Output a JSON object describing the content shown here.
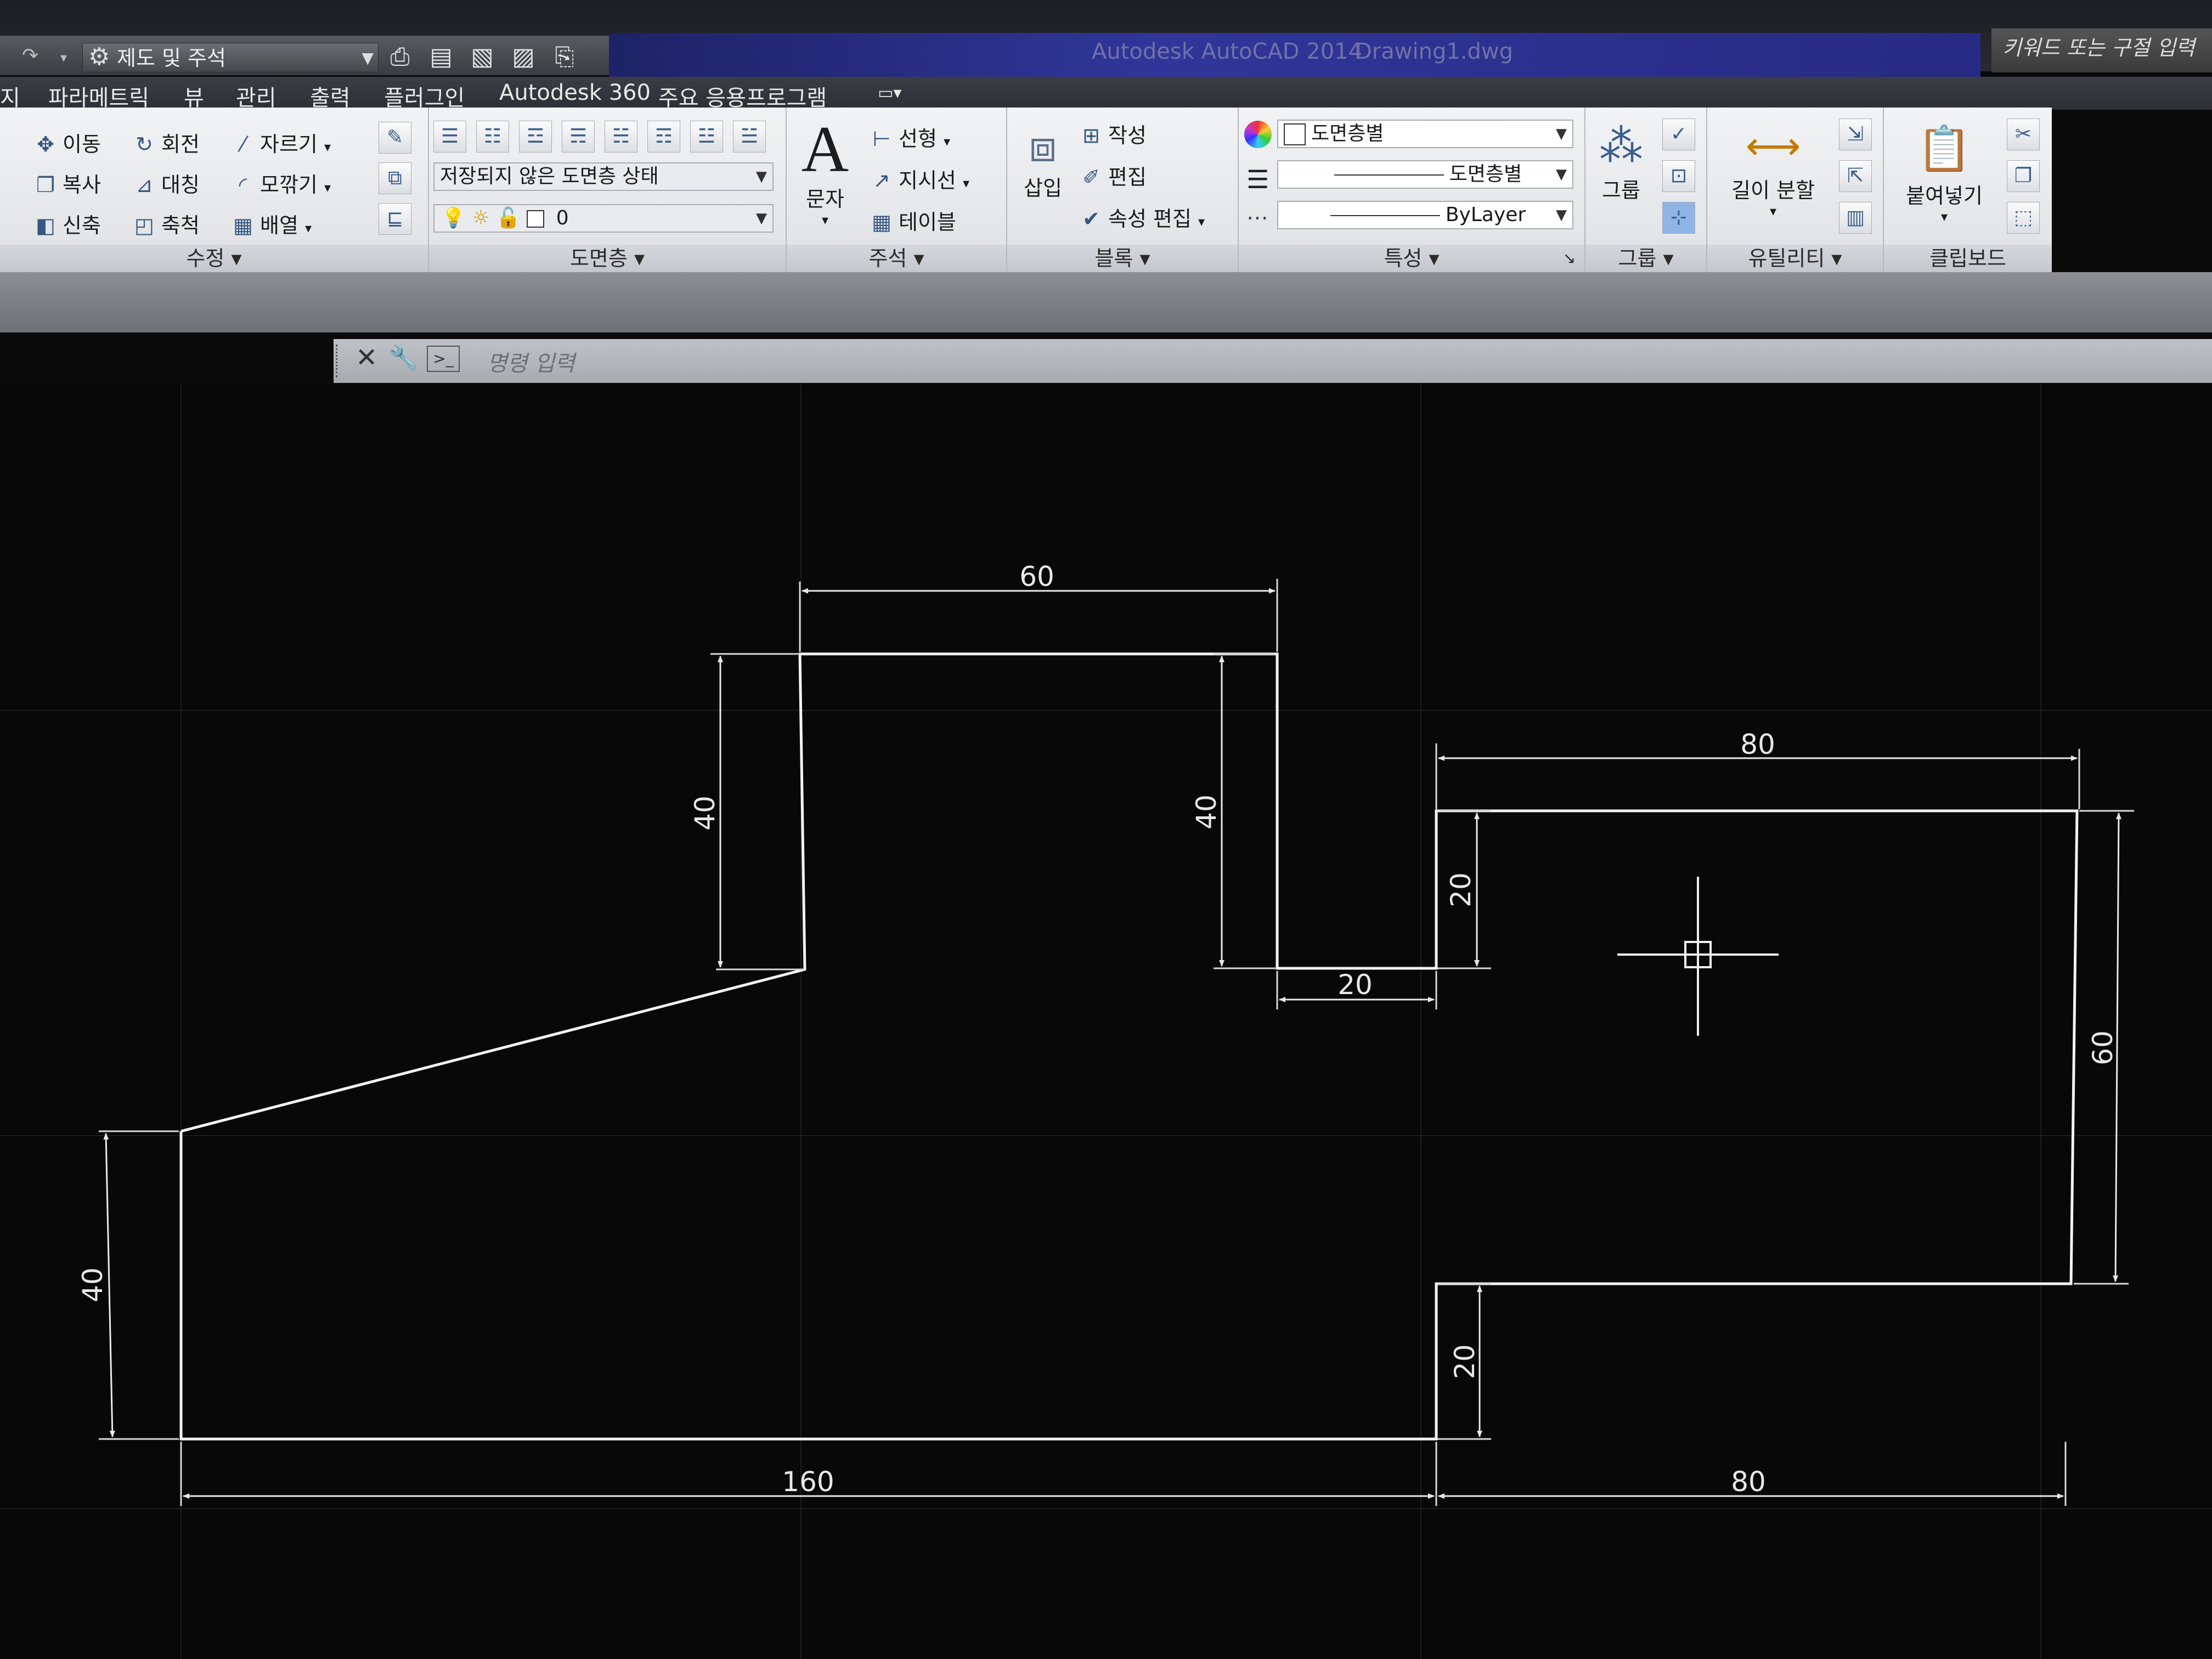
{
  "qat": {
    "workspace": "제도 및 주석"
  },
  "app": {
    "title": "Autodesk AutoCAD 2014",
    "file": "Drawing1.dwg",
    "search_placeholder": "키워드 또는 구절 입력"
  },
  "tabs": [
    "지",
    "파라메트릭",
    "뷰",
    "관리",
    "출력",
    "플러그인",
    "Autodesk 360",
    "주요 응용프로그램"
  ],
  "ribbon": {
    "modify": {
      "title": "수정",
      "move": "이동",
      "rotate": "회전",
      "trim": "자르기",
      "copy": "복사",
      "mirror": "대칭",
      "fillet": "모깎기",
      "stretch": "신축",
      "scale": "축척",
      "array": "배열"
    },
    "layers": {
      "title": "도면층",
      "state": "저장되지 않은 도면층 상태",
      "current_layer": "0"
    },
    "annotation": {
      "title": "주석",
      "text_big": "A",
      "text": "문자",
      "linear": "선형",
      "leader": "지시선",
      "table": "테이블"
    },
    "block": {
      "title": "블록",
      "insert": "삽입",
      "create": "작성",
      "edit": "편집",
      "edit_attributes": "속성 편집"
    },
    "properties": {
      "title": "특성",
      "color": "도면층별",
      "lineweight": "도면층별",
      "linetype": "ByLayer"
    },
    "groups": {
      "title": "그룹",
      "group": "그룹"
    },
    "utilities": {
      "title": "유틸리티",
      "measure": "길이 분할"
    },
    "clipboard": {
      "title": "클립보드",
      "paste": "붙여넣기"
    }
  },
  "command": {
    "placeholder": "명령 입력"
  },
  "drawing": {
    "dimensions": {
      "top_width": "60",
      "left_height": "40",
      "inner_height": "40",
      "right_width": "80",
      "notch_depth": "20",
      "notch_width": "20",
      "right_height": "60",
      "lower_notch": "20",
      "left_bottom_height": "40",
      "bottom_left": "160",
      "bottom_right": "80"
    }
  }
}
